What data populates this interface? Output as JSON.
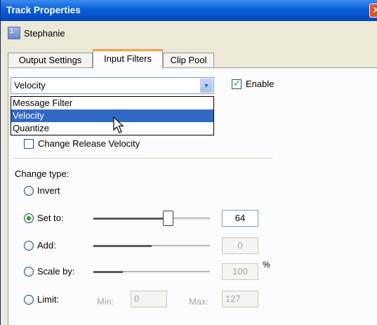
{
  "window": {
    "title": "Track Properties",
    "close_glyph": "✕"
  },
  "track": {
    "number": "1",
    "name": "Stephanie"
  },
  "tabs": [
    {
      "label": "Output Settings",
      "active": false
    },
    {
      "label": "Input Filters",
      "active": true
    },
    {
      "label": "Clip Pool",
      "active": false
    }
  ],
  "filter": {
    "selected": "Velocity",
    "arrow_icon": "chevron-down-icon",
    "enable_label": "Enable",
    "enable_checked": true,
    "options": [
      "Message Filter",
      "Velocity",
      "Quantize"
    ],
    "highlighted_option": "Velocity"
  },
  "change_release_label": "Change Release Velocity",
  "change_release_checked": false,
  "change_type": {
    "label": "Change type:",
    "invert_label": "Invert",
    "set_to": {
      "label": "Set to:",
      "value": "64",
      "level": 0.64,
      "selected": true
    },
    "add": {
      "label": "Add:",
      "value": "0",
      "level": 0.5,
      "selected": false
    },
    "scale_by": {
      "label": "Scale by:",
      "value": "100",
      "unit": "%",
      "level": 0.25,
      "selected": false
    },
    "limit": {
      "label": "Limit:",
      "min_label": "Min:",
      "min_value": "0",
      "max_label": "Max:",
      "max_value": "127",
      "selected": false
    }
  },
  "colors": {
    "title_bar": "#0a5fd8",
    "tab_accent": "#f3a43b",
    "selection": "#316ac5",
    "check_green": "#21a121"
  }
}
